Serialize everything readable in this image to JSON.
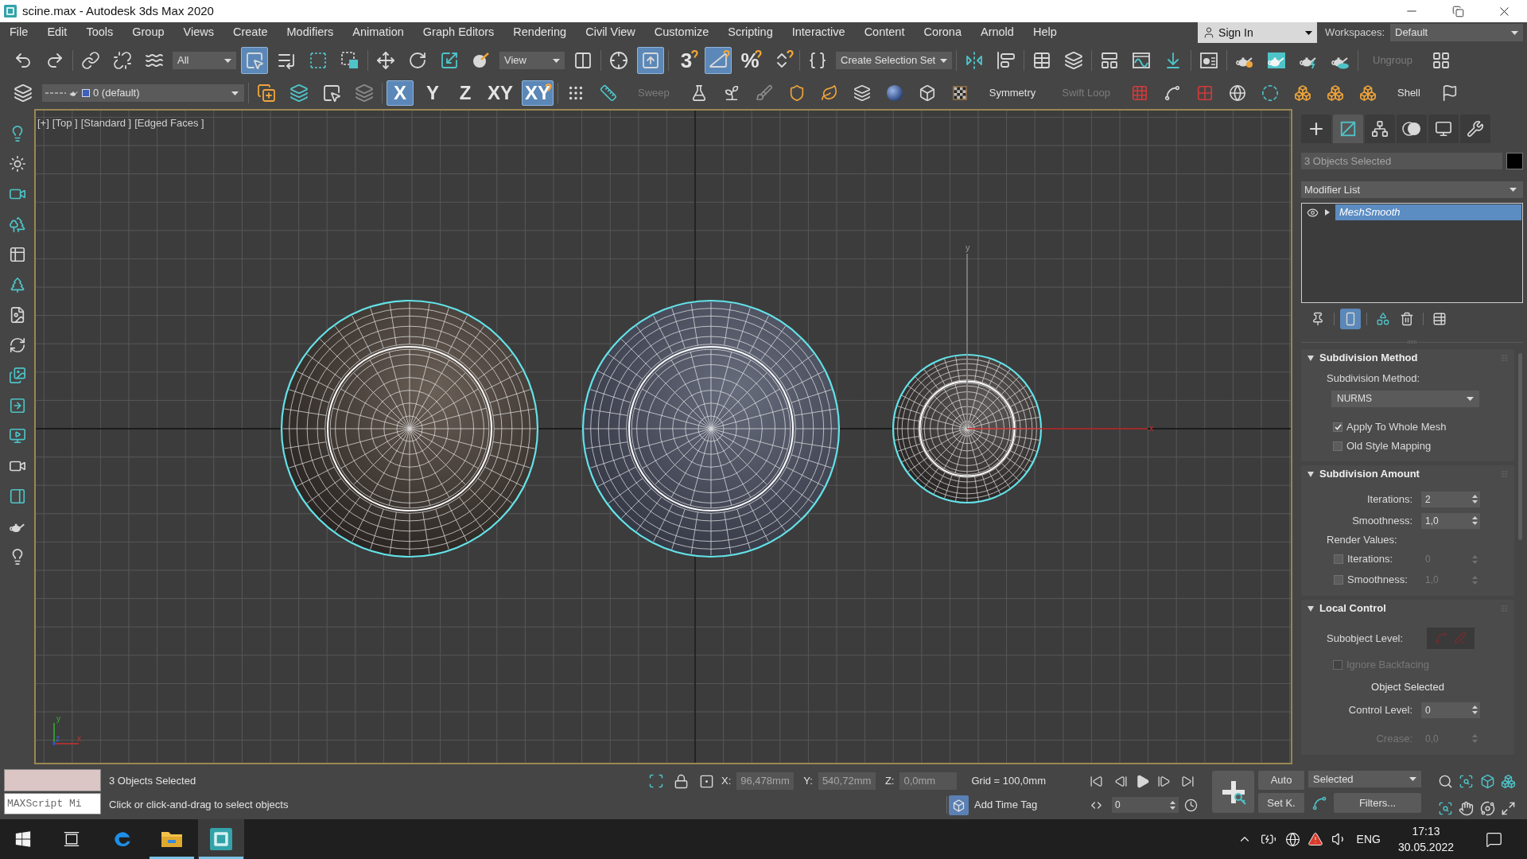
{
  "window": {
    "title": "scine.max - Autodesk 3ds Max 2020"
  },
  "menu_bar": [
    "File",
    "Edit",
    "Tools",
    "Group",
    "Views",
    "Create",
    "Modifiers",
    "Animation",
    "Graph Editors",
    "Rendering",
    "Civil View",
    "Customize",
    "Scripting",
    "Interactive",
    "Content",
    "Corona",
    "Arnold",
    "Help"
  ],
  "account": {
    "label": "Sign In"
  },
  "workspaces": {
    "label": "Workspaces:",
    "value": "Default"
  },
  "main_toolbar": [
    [
      {
        "kind": "icon",
        "active": false
      },
      {
        "kind": "icon",
        "active": false
      }
    ],
    [
      {
        "kind": "icon",
        "active": false
      },
      {
        "kind": "icon",
        "active": false
      },
      {
        "kind": "icon",
        "active": false
      },
      {
        "kind": "dropdown",
        "value": "All"
      },
      {
        "kind": "icon",
        "active": true
      },
      {
        "kind": "icon",
        "active": false
      },
      {
        "kind": "icon",
        "active": false
      },
      {
        "kind": "icon",
        "active": false
      }
    ],
    [
      {
        "kind": "icon",
        "active": false
      },
      {
        "kind": "icon",
        "active": false
      },
      {
        "kind": "icon",
        "active": false
      },
      {
        "kind": "icon",
        "active": false
      },
      {
        "kind": "dropdown",
        "value": "View"
      },
      {
        "kind": "icon",
        "active": false
      }
    ],
    [
      {
        "kind": "icon",
        "active": false
      },
      {
        "kind": "icon",
        "active": true
      }
    ],
    [
      {
        "kind": "glyph",
        "label": "3",
        "active": false
      },
      {
        "kind": "icon",
        "active": true
      },
      {
        "kind": "glyph",
        "label": "%",
        "active": false
      },
      {
        "kind": "icon",
        "active": false
      }
    ],
    [
      {
        "kind": "icon",
        "active": false
      },
      {
        "kind": "dropdown",
        "value": "Create Selection Set"
      }
    ],
    [
      {
        "kind": "icon",
        "active": false
      },
      {
        "kind": "icon",
        "active": false
      }
    ],
    [
      {
        "kind": "icon",
        "active": false
      },
      {
        "kind": "icon",
        "active": false
      }
    ],
    [
      {
        "kind": "icon",
        "active": false
      },
      {
        "kind": "icon",
        "active": false
      },
      {
        "kind": "icon",
        "active": false
      }
    ],
    [
      {
        "kind": "icon",
        "active": false
      }
    ],
    [
      {
        "kind": "icon",
        "active": false
      },
      {
        "kind": "icon",
        "active": false
      },
      {
        "kind": "icon",
        "active": false
      },
      {
        "kind": "icon",
        "active": false
      }
    ],
    [
      {
        "kind": "text",
        "label": "Ungroup",
        "disabled": true
      },
      {
        "kind": "icon",
        "active": false
      }
    ]
  ],
  "secondary_toolbar": [
    [
      {
        "kind": "icon",
        "active": false
      },
      {
        "kind": "layer_dropdown",
        "value": "0 (default)"
      }
    ],
    [
      {
        "kind": "icon",
        "active": false
      },
      {
        "kind": "icon",
        "active": false
      },
      {
        "kind": "icon",
        "active": false
      },
      {
        "kind": "icon",
        "active": false
      }
    ],
    [
      {
        "kind": "glyph",
        "label": "X",
        "active": true
      },
      {
        "kind": "glyph",
        "label": "Y",
        "active": false
      },
      {
        "kind": "glyph",
        "label": "Z",
        "active": false
      },
      {
        "kind": "glyph",
        "label": "XY",
        "active": false
      },
      {
        "kind": "glyph",
        "label": "XY",
        "active": true
      }
    ],
    [
      {
        "kind": "icon",
        "active": false
      },
      {
        "kind": "icon",
        "active": false
      },
      {
        "kind": "text",
        "label": "Sweep",
        "disabled": true
      },
      {
        "kind": "icon",
        "active": false
      },
      {
        "kind": "icon",
        "active": false
      },
      {
        "kind": "icon",
        "active": false
      },
      {
        "kind": "icon",
        "active": false
      },
      {
        "kind": "icon",
        "active": false
      },
      {
        "kind": "icon",
        "active": false
      },
      {
        "kind": "icon",
        "active": false
      },
      {
        "kind": "icon",
        "active": false
      },
      {
        "kind": "icon",
        "active": false
      },
      {
        "kind": "text",
        "label": "Symmetry",
        "disabled": false
      },
      {
        "kind": "text",
        "label": "Swift Loop",
        "disabled": true
      },
      {
        "kind": "icon",
        "active": false
      },
      {
        "kind": "icon",
        "active": false
      },
      {
        "kind": "icon",
        "active": false
      },
      {
        "kind": "icon",
        "active": false
      },
      {
        "kind": "icon",
        "active": false
      },
      {
        "kind": "icon",
        "active": false
      },
      {
        "kind": "icon",
        "active": false
      },
      {
        "kind": "icon",
        "active": false
      },
      {
        "kind": "text",
        "label": "Shell",
        "disabled": false
      },
      {
        "kind": "icon",
        "active": false
      }
    ]
  ],
  "viewport": {
    "labels": [
      "[+]",
      "[Top ]",
      "[Standard ]",
      "[Edged Faces ]"
    ],
    "objects": [
      {
        "selected": true
      },
      {
        "selected": true
      },
      {
        "selected": true
      }
    ],
    "gizmo_labels": [
      "y",
      "x"
    ],
    "axis_tripod_labels": [
      "y",
      "z",
      "x"
    ]
  },
  "command_panel": {
    "tabs": [
      {
        "selected": false
      },
      {
        "selected": true
      },
      {
        "selected": false
      },
      {
        "selected": false
      },
      {
        "selected": false
      },
      {
        "selected": false
      }
    ],
    "name_field": {
      "value": "3 Objects Selected"
    },
    "modifier_list": {
      "value": "Modifier List"
    },
    "modifier_stack": [
      {
        "label": "MeshSmooth",
        "selected": true
      }
    ],
    "stack_tools": [
      {
        "active": false
      },
      {
        "active": true
      },
      {
        "active": false
      },
      {
        "active": false
      },
      {
        "active": false
      }
    ],
    "rollouts": [
      {
        "title": "Subdivision Method",
        "expanded": true,
        "rows": [
          {
            "kind": "label",
            "label": "Subdivision Method:"
          },
          {
            "kind": "dropdown",
            "value": "NURMS"
          },
          {
            "kind": "checkbox",
            "label": "Apply To Whole Mesh",
            "checked": true,
            "disabled": false
          },
          {
            "kind": "checkbox",
            "label": "Old Style Mapping",
            "checked": false,
            "disabled": false
          }
        ]
      },
      {
        "title": "Subdivision Amount",
        "expanded": true,
        "rows": [
          {
            "kind": "spinner",
            "label": "Iterations:",
            "value": "2",
            "disabled": false
          },
          {
            "kind": "spinner",
            "label": "Smoothness:",
            "value": "1,0",
            "disabled": false
          },
          {
            "kind": "label",
            "label": "Render Values:"
          },
          {
            "kind": "check_spinner",
            "label": "Iterations:",
            "value": "0",
            "checked": false,
            "disabled": true
          },
          {
            "kind": "check_spinner",
            "label": "Smoothness:",
            "value": "1,0",
            "checked": false,
            "disabled": true
          }
        ]
      },
      {
        "title": "Local Control",
        "expanded": true,
        "rows": [
          {
            "kind": "subobject",
            "label": "Subobject Level:"
          },
          {
            "kind": "checkbox",
            "label": "Ignore Backfacing",
            "checked": false,
            "disabled": true
          },
          {
            "kind": "center_label",
            "label": "Object Selected"
          },
          {
            "kind": "spinner",
            "label": "Control Level:",
            "value": "0",
            "disabled": false
          },
          {
            "kind": "spinner",
            "label": "Crease:",
            "value": "0,0",
            "disabled": true
          }
        ]
      }
    ]
  },
  "status": {
    "maxscript": {
      "placeholder": "MAXScript Mi"
    },
    "selection": "3 Objects Selected",
    "prompt": "Click or click-and-drag to select objects",
    "coords": [
      {
        "label": "X:",
        "value": "96,478mm"
      },
      {
        "label": "Y:",
        "value": "540,72mm"
      },
      {
        "label": "Z:",
        "value": "0,0mm"
      }
    ],
    "grid": "Grid = 100,0mm",
    "time_tag": "Add Time Tag",
    "frame": "0",
    "auto_key": {
      "label": "Auto",
      "active": false
    },
    "set_key": "Set K.",
    "key_filter": "Selected",
    "filters": "Filters..."
  },
  "taskbar": {
    "apps": [
      {
        "running": false,
        "selected": false
      },
      {
        "running": true,
        "selected": false
      },
      {
        "running": true,
        "selected": true
      }
    ],
    "language": "ENG",
    "time": "17:13",
    "date": "30.05.2022"
  }
}
